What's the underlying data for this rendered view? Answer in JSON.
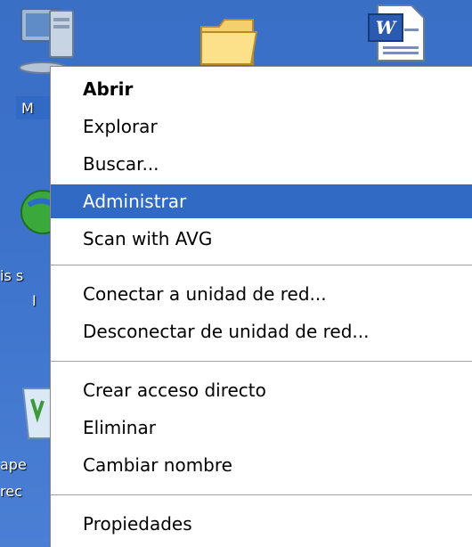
{
  "desktop": {
    "labels": {
      "my_computer_fragment": "M",
      "network_fragment_1": "is s",
      "network_fragment_2": "I",
      "recycle_fragment_1": "ape",
      "recycle_fragment_2": "rec"
    },
    "icons": [
      {
        "name": "my-computer-icon"
      },
      {
        "name": "folder-icon"
      },
      {
        "name": "word-document-icon"
      },
      {
        "name": "internet-explorer-icon"
      },
      {
        "name": "recycle-bin-icon"
      }
    ]
  },
  "context_menu": {
    "items": [
      {
        "label": "Abrir",
        "bold": true
      },
      {
        "label": "Explorar"
      },
      {
        "label": "Buscar..."
      },
      {
        "label": "Administrar",
        "highlighted": true
      },
      {
        "label": "Scan with AVG"
      },
      {
        "label": "Conectar a unidad de red..."
      },
      {
        "label": "Desconectar de unidad de red..."
      },
      {
        "label": "Crear acceso directo"
      },
      {
        "label": "Eliminar"
      },
      {
        "label": "Cambiar nombre"
      },
      {
        "label": "Propiedades"
      }
    ],
    "highlight_color": "#316ac5"
  }
}
